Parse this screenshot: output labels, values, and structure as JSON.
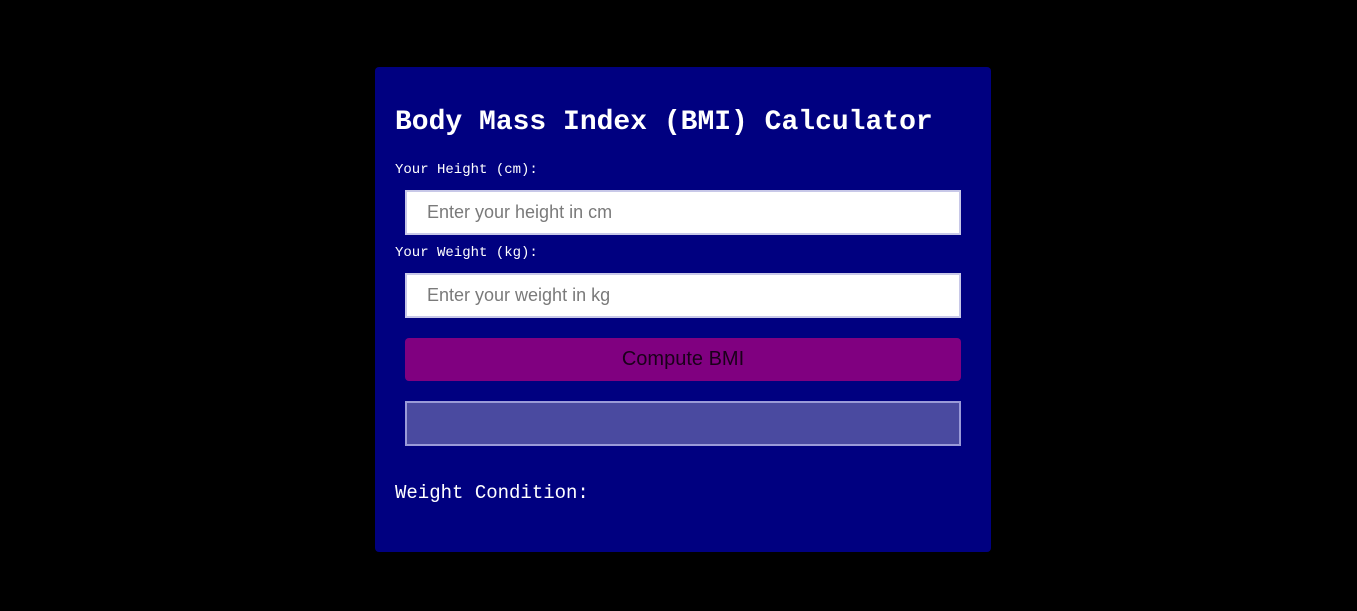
{
  "app": {
    "title": "Body Mass Index (BMI) Calculator"
  },
  "form": {
    "height_label": "Your Height (cm):",
    "height_value": "",
    "height_placeholder": "Enter your height in cm",
    "weight_label": "Your Weight (kg):",
    "weight_value": "",
    "weight_placeholder": "Enter your weight in kg",
    "compute_label": "Compute BMI",
    "result_value": "",
    "condition_label": "Weight Condition:"
  },
  "colors": {
    "page_background": "#000000",
    "card_background": "#000080",
    "button_background": "#800080",
    "result_background": "#4a4aa0",
    "text": "#ffffff"
  }
}
